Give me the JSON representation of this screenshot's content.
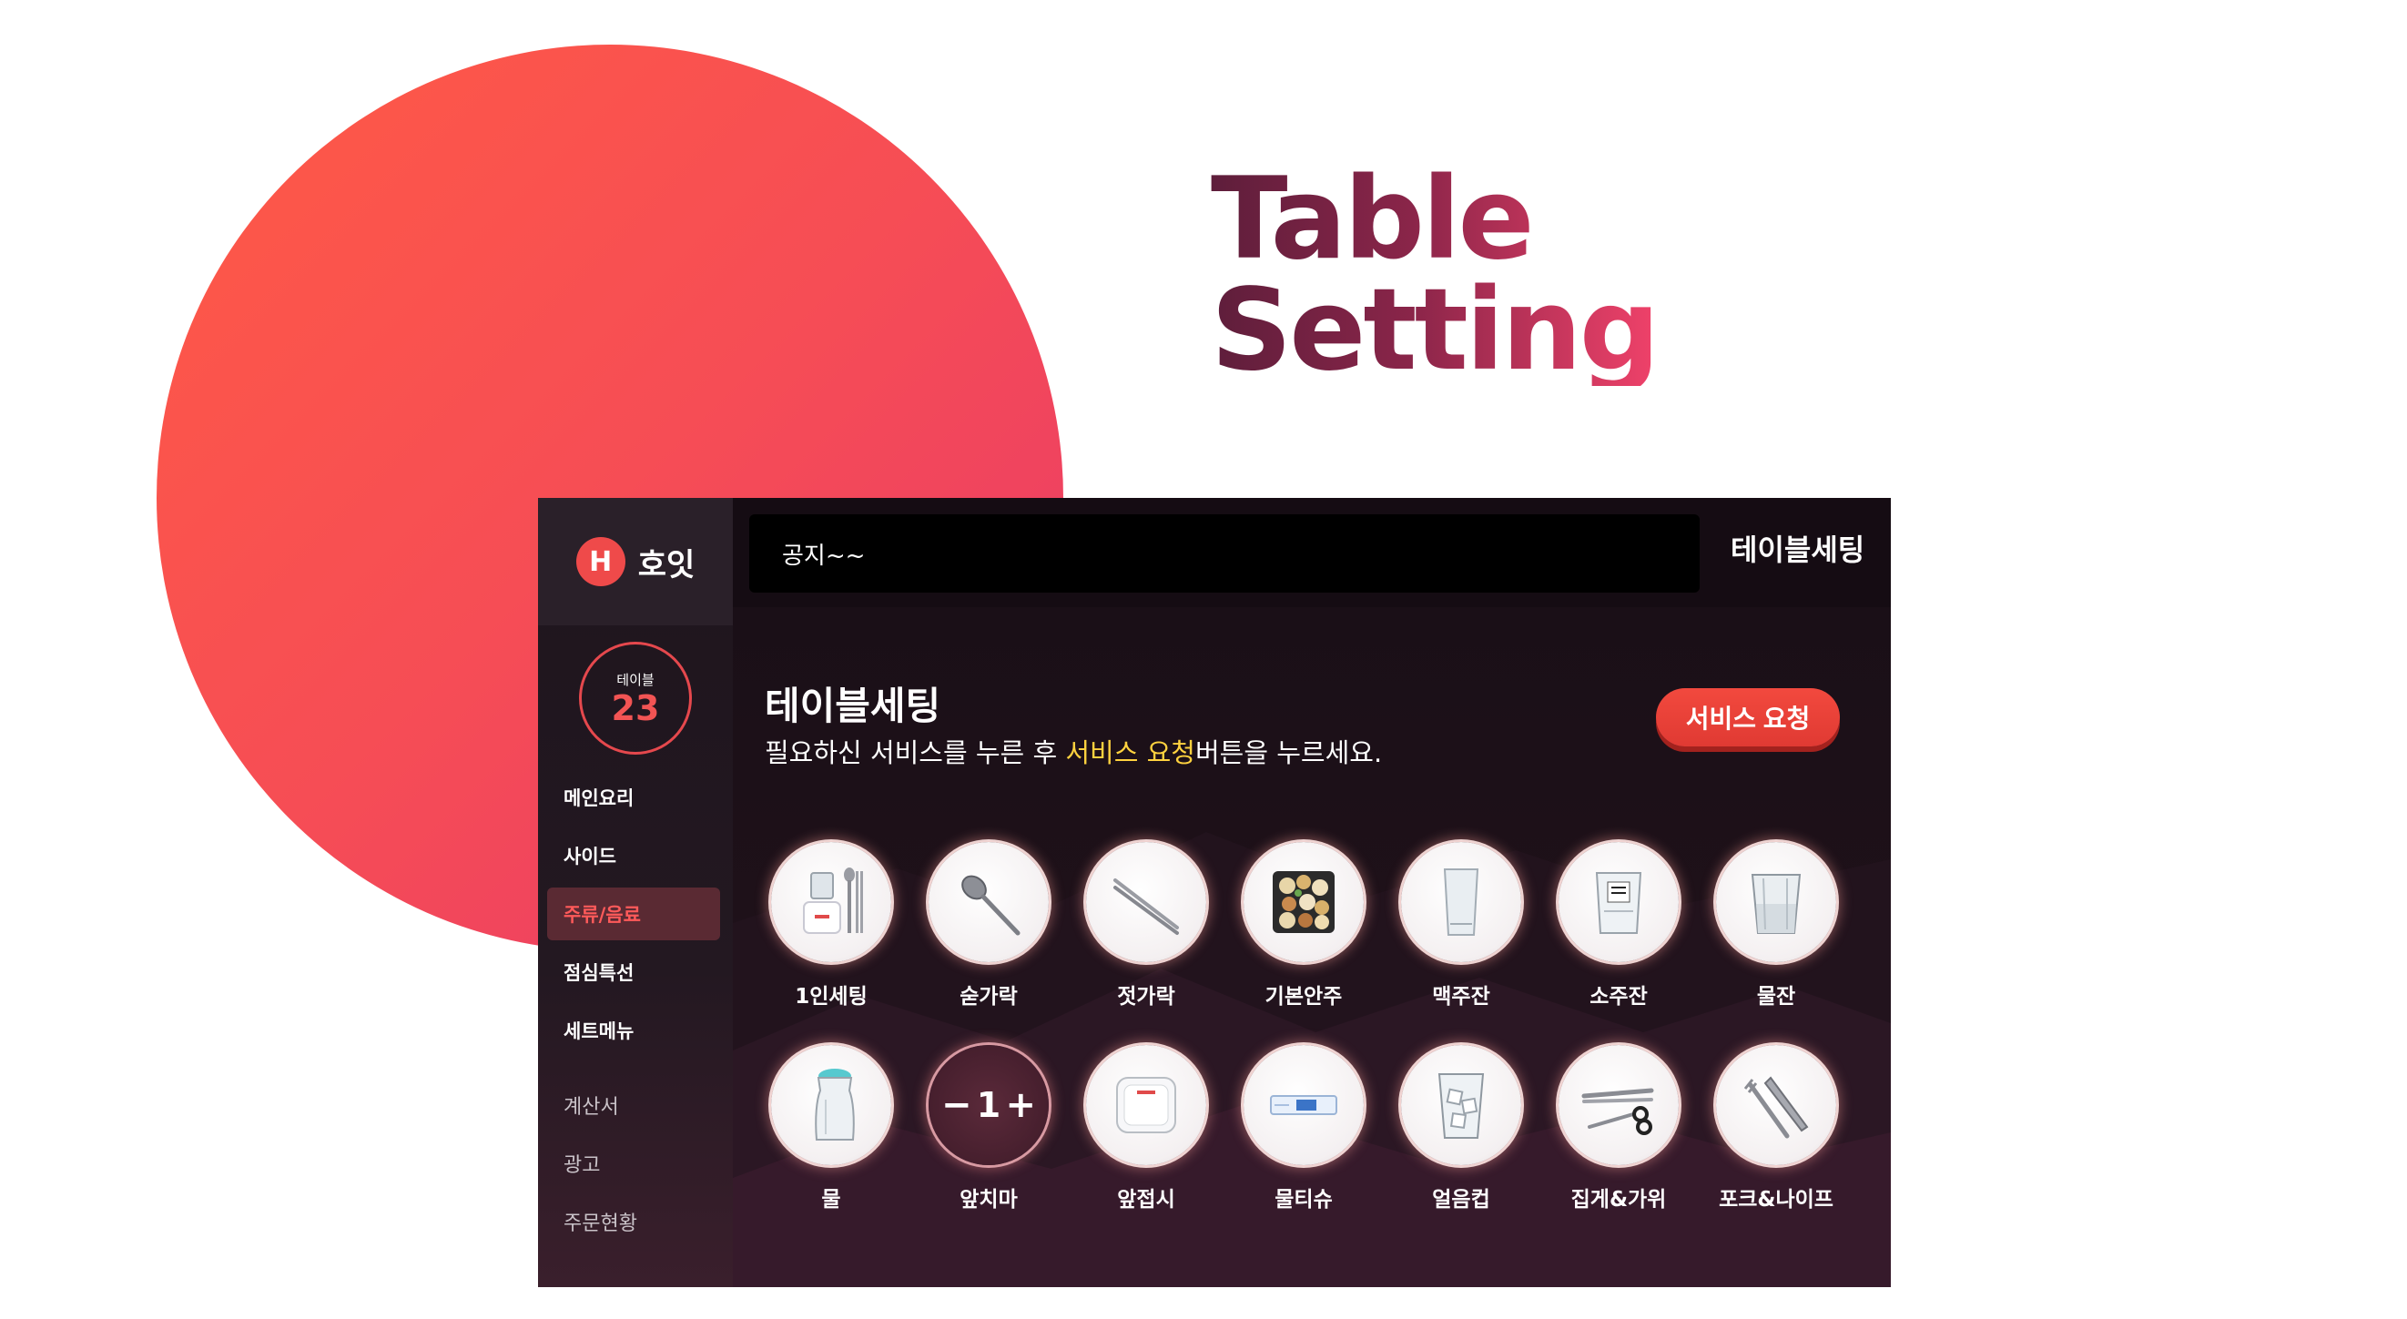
{
  "headline": {
    "line1": "Table",
    "line2": "Setting"
  },
  "app": {
    "logo_letter": "H",
    "logo_text": "호잇"
  },
  "table": {
    "label": "테이블",
    "number": "23"
  },
  "sidebar": {
    "items": [
      {
        "label": "메인요리",
        "active": false
      },
      {
        "label": "사이드",
        "active": false
      },
      {
        "label": "주류/음료",
        "active": true
      },
      {
        "label": "점심특선",
        "active": false
      },
      {
        "label": "세트메뉴",
        "active": false
      }
    ],
    "bottom_items": [
      {
        "label": "계산서"
      },
      {
        "label": "광고"
      },
      {
        "label": "주문현황"
      }
    ]
  },
  "notice": {
    "text": "공지~~"
  },
  "header": {
    "title": "테이블세팅"
  },
  "main": {
    "title": "테이블세팅",
    "subtitle_before": "필요하신 서비스를 누른 후 ",
    "subtitle_highlight": "서비스 요청",
    "subtitle_after": "버튼을 누르세요.",
    "service_button": "서비스 요청"
  },
  "items": [
    {
      "label": "1인세팅",
      "icon": "personal-set-icon"
    },
    {
      "label": "숟가락",
      "icon": "spoon-icon"
    },
    {
      "label": "젓가락",
      "icon": "chopsticks-icon"
    },
    {
      "label": "기본안주",
      "icon": "snack-icon"
    },
    {
      "label": "맥주잔",
      "icon": "beer-glass-icon"
    },
    {
      "label": "소주잔",
      "icon": "soju-glass-icon"
    },
    {
      "label": "물잔",
      "icon": "water-glass-icon"
    },
    {
      "label": "물",
      "icon": "water-bottle-icon"
    },
    {
      "label": "앞치마",
      "icon": "apron-icon",
      "quantity": "1",
      "minus": "−",
      "plus": "+"
    },
    {
      "label": "앞접시",
      "icon": "plate-icon"
    },
    {
      "label": "물티슈",
      "icon": "wet-tissue-icon"
    },
    {
      "label": "얼음컵",
      "icon": "ice-cup-icon"
    },
    {
      "label": "집게&가위",
      "icon": "tongs-scissors-icon"
    },
    {
      "label": "포크&나이프",
      "icon": "fork-knife-icon"
    }
  ],
  "colors": {
    "accent": "#ef4a4a",
    "highlight": "#ffd23f",
    "circle": "#f64d55"
  }
}
